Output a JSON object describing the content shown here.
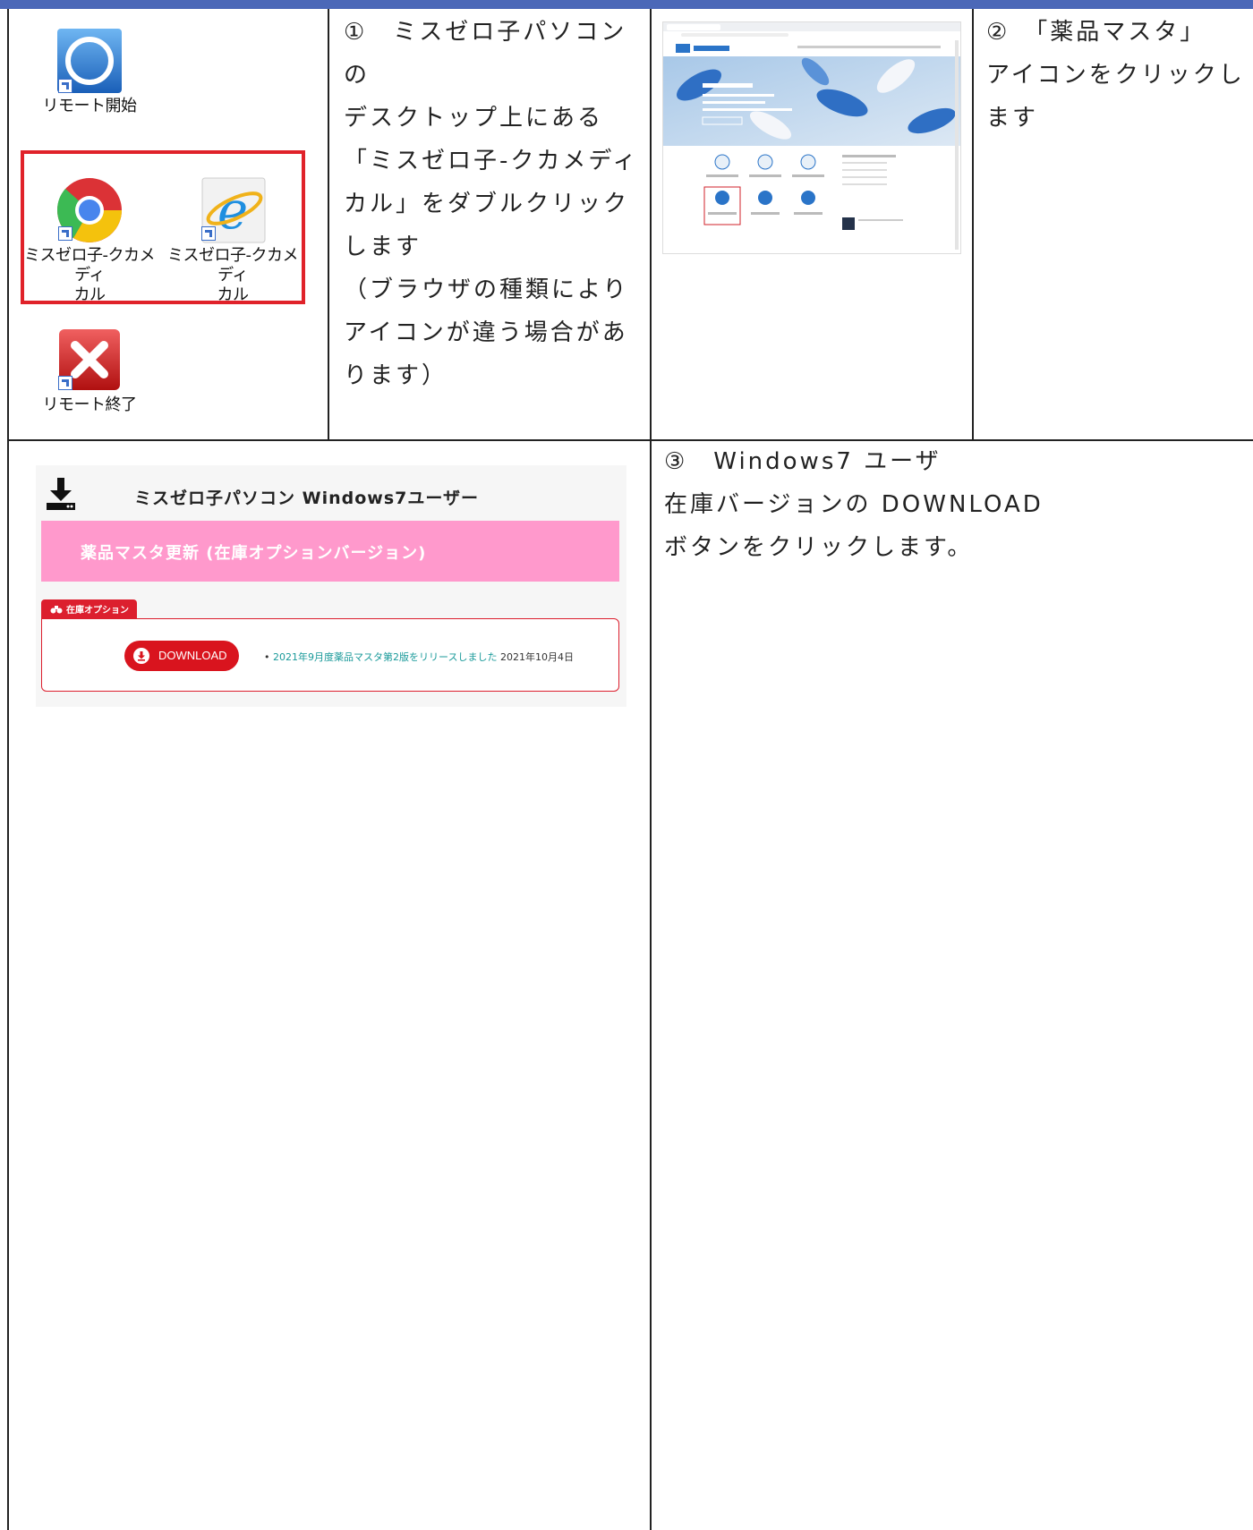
{
  "colors": {
    "header_bar": "#4b68b8",
    "highlight_box": "#e0222a",
    "pink_bar": "#ff99cc",
    "accent_red": "#d9141e",
    "link_teal": "#1a9a9a"
  },
  "desktop": {
    "icons": [
      {
        "label": "リモート開始",
        "icon": "remote-start-icon"
      },
      {
        "label_line1": "ミスゼロ子-クカメディ",
        "label_line2": "カル",
        "icon": "chrome-icon"
      },
      {
        "label_line1": "ミスゼロ子-クカメディ",
        "label_line2": "カル",
        "icon": "internet-explorer-icon"
      },
      {
        "label": "リモート終了",
        "icon": "remote-end-icon"
      }
    ]
  },
  "steps": {
    "step1": {
      "lines": [
        "①　ミスゼロ子パソコンの",
        "デスクトップ上にある",
        "「ミスゼロ子-クカメディ",
        "カル」をダブルクリック",
        "します",
        "（ブラウザの種類により",
        "アイコンが違う場合があ",
        "ります）"
      ]
    },
    "step2": {
      "lines": [
        "②　「薬品マスタ」",
        "アイコンをクリックし",
        "ます"
      ]
    },
    "step3": {
      "lines": [
        "③　Windows7 ユーザ",
        "在庫バージョンの DOWNLOAD",
        "ボタンをクリックします。"
      ]
    }
  },
  "download_panel": {
    "title": "ミスゼロ子パソコン Windows7ユーザー",
    "section_title": "薬品マスタ更新 (在庫オプションバージョン)",
    "tab_label": "在庫オプション",
    "button_label": "DOWNLOAD",
    "release_link": "2021年9月度薬品マスタ第2版をリリースしました",
    "release_date": "2021年10月4日"
  }
}
